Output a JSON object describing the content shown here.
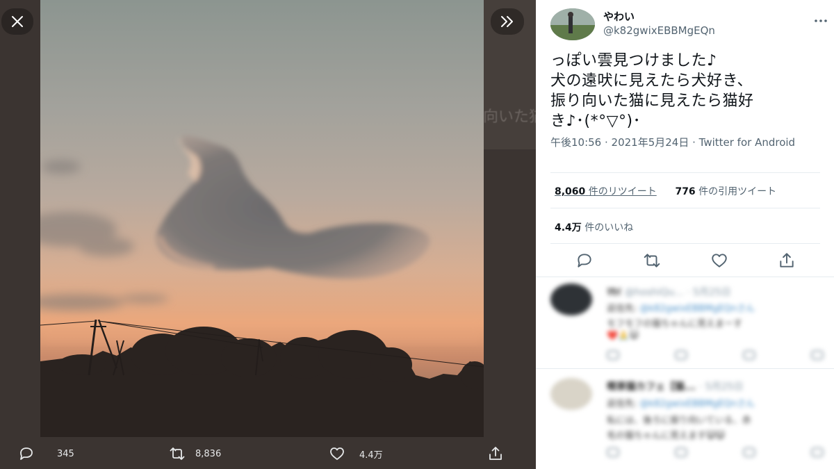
{
  "viewer": {
    "ghost_text": "向いた猫",
    "actions": {
      "reply_count": "345",
      "retweet_count": "8,836",
      "like_count": "4.4万"
    },
    "icons": {
      "close": "close-icon",
      "expand": "chevrons-right-icon",
      "reply": "reply-icon",
      "retweet": "retweet-icon",
      "like": "heart-icon",
      "share": "share-icon"
    }
  },
  "tweet": {
    "author_name": "やわい",
    "author_handle": "@k82gwixEBBMgEQn",
    "text": "っぽい雲見つけました♪\n犬の遠吠に見えたら犬好き、\n振り向いた猫に見えたら猫好\nき♪･(*°▽°)･",
    "meta": "午後10:56 · 2021年5月24日 · Twitter for Android",
    "retweets_number": "8,060",
    "retweets_label": "件のリツイート",
    "quotes_number": "776",
    "quotes_label": "件の引用ツイート",
    "likes_number": "4.4万",
    "likes_label": "件のいいね"
  },
  "replies": [
    {
      "name": "ﾏﾓｲ",
      "handle": "@hoshiQu... · 5月25日",
      "line1_prefix": "返信先: ",
      "line1_mention": "@k82gwixEBBMgEQnさん",
      "line2": "モフモフの猫ちゃんに見えまーす",
      "line3": "❤️🙏😺"
    },
    {
      "name": "喫茶猫カフェ【猫...",
      "handle": "· 5月25日",
      "line1_prefix": "返信先: ",
      "line1_mention": "@k82gwixEBBMgEQnさん",
      "line2": "私には、後ろに振り向いている、赤",
      "line3": "毛の猫ちゃんに見えます😺😺"
    }
  ],
  "colors": {
    "panel_bg": "#ffffff",
    "viewer_bg": "#3b3431",
    "text_primary": "#0f1419",
    "text_secondary": "#536471",
    "accent_blue": "#1d9bf0",
    "like_red": "#e0245e"
  }
}
